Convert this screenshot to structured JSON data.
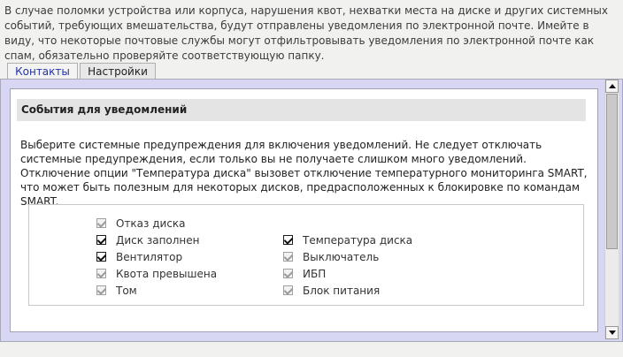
{
  "intro_text": "В случае поломки устройства или корпуса, нарушения квот, нехватки места на диске и других системных событий, требующих вмешательства, будут отправлены уведомления по электронной почте. Имейте в виду, что некоторые почтовые службы могут отфильтровывать уведомления по электронной почте как спам, обязательно проверяйте соответствующую папку.",
  "tabs": [
    {
      "label": "Контакты",
      "active": false
    },
    {
      "label": "Настройки",
      "active": true
    }
  ],
  "section": {
    "title": "События для уведомлений",
    "description": "Выберите системные предупреждения для включения уведомлений. Не следует отключать системные предупреждения, если только вы не получаете слишком много уведомлений. Отключение опции \"Температура диска\" вызовет отключение температурного мониторинга SMART, что может быть полезным для некоторых дисков, предрасположенных к блокировке по командам SMART."
  },
  "events": {
    "left": [
      {
        "label": "Отказ диска",
        "checked": true,
        "disabled": true
      },
      {
        "label": "Диск заполнен",
        "checked": true,
        "disabled": false
      },
      {
        "label": "Вентилятор",
        "checked": true,
        "disabled": false
      },
      {
        "label": "Квота превышена",
        "checked": true,
        "disabled": true
      },
      {
        "label": "Том",
        "checked": true,
        "disabled": true
      }
    ],
    "right": [
      {
        "label": "Температура диска",
        "checked": true,
        "disabled": false
      },
      {
        "label": "Выключатель",
        "checked": true,
        "disabled": true
      },
      {
        "label": "ИБП",
        "checked": true,
        "disabled": true
      },
      {
        "label": "Блок питания",
        "checked": true,
        "disabled": true
      }
    ]
  },
  "colors": {
    "frame_bg": "#d7d7f3",
    "tab_link": "#2233aa",
    "section_header_bg": "#e4e4e4"
  }
}
